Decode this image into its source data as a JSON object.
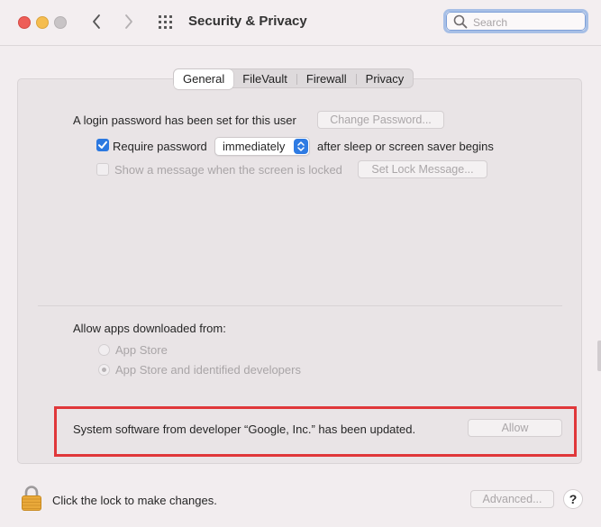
{
  "window": {
    "title": "Security & Privacy",
    "search_placeholder": "Search"
  },
  "tabs": [
    {
      "label": "General",
      "active": true
    },
    {
      "label": "FileVault",
      "active": false
    },
    {
      "label": "Firewall",
      "active": false
    },
    {
      "label": "Privacy",
      "active": false
    }
  ],
  "general": {
    "login_password_text": "A login password has been set for this user",
    "change_password_label": "Change Password...",
    "require_password_label": "Require password",
    "require_password_checked": true,
    "require_password_delay": "immediately",
    "after_sleep_text": "after sleep or screen saver begins",
    "show_message_label": "Show a message when the screen is locked",
    "show_message_checked": false,
    "set_lock_message_label": "Set Lock Message..."
  },
  "allow_apps": {
    "heading": "Allow apps downloaded from:",
    "options": [
      {
        "label": "App Store",
        "selected": false
      },
      {
        "label": "App Store and identified developers",
        "selected": true
      }
    ]
  },
  "system_software": {
    "message": "System software from developer “Google, Inc.” has been updated.",
    "allow_label": "Allow"
  },
  "footer": {
    "lock_text": "Click the lock to make changes.",
    "advanced_label": "Advanced...",
    "help_label": "?"
  },
  "colors": {
    "accent": "#2b78e0",
    "highlight_border": "#e0373a",
    "lock_gold": "#e9a93a"
  }
}
